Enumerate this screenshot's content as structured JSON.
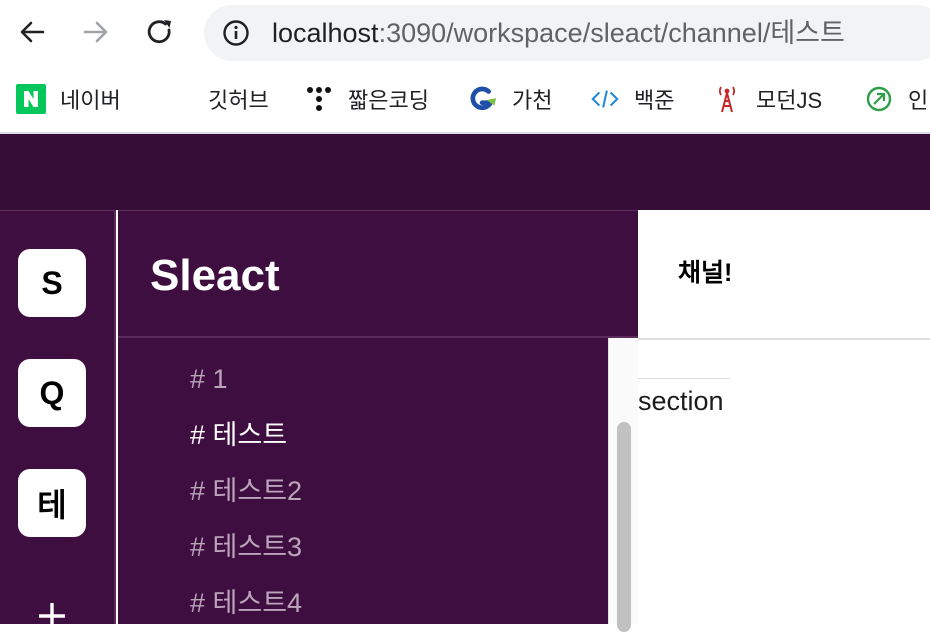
{
  "browser": {
    "url_host": "localhost",
    "url_rest": ":3090/workspace/sleact/channel/테스트",
    "bookmarks": [
      {
        "label": "네이버",
        "icon": "naver-icon"
      },
      {
        "label": "깃허브",
        "icon": "blank"
      },
      {
        "label": "짧은코딩",
        "icon": "dots-logo-icon"
      },
      {
        "label": "가천",
        "icon": "gachon-logo-icon"
      },
      {
        "label": "백준",
        "icon": "code-brackets-icon"
      },
      {
        "label": "모던JS",
        "icon": "radio-tower-icon"
      },
      {
        "label": "인",
        "icon": "leaf-circle-icon"
      }
    ]
  },
  "workspaces": [
    "S",
    "Q",
    "테"
  ],
  "workspace": {
    "name": "Sleact"
  },
  "channels": [
    {
      "label": "# 1",
      "active": false
    },
    {
      "label": "# 테스트",
      "active": true
    },
    {
      "label": "# 테스트2",
      "active": false
    },
    {
      "label": "# 테스트3",
      "active": false
    },
    {
      "label": "# 테스트4",
      "active": false
    }
  ],
  "chat": {
    "header": "채널!",
    "section_label": "section"
  },
  "colors": {
    "app_header": "#350d36",
    "sidebar": "#3f0e40",
    "channel_active": "#ffffff",
    "channel_inactive": "#bba5bb"
  }
}
